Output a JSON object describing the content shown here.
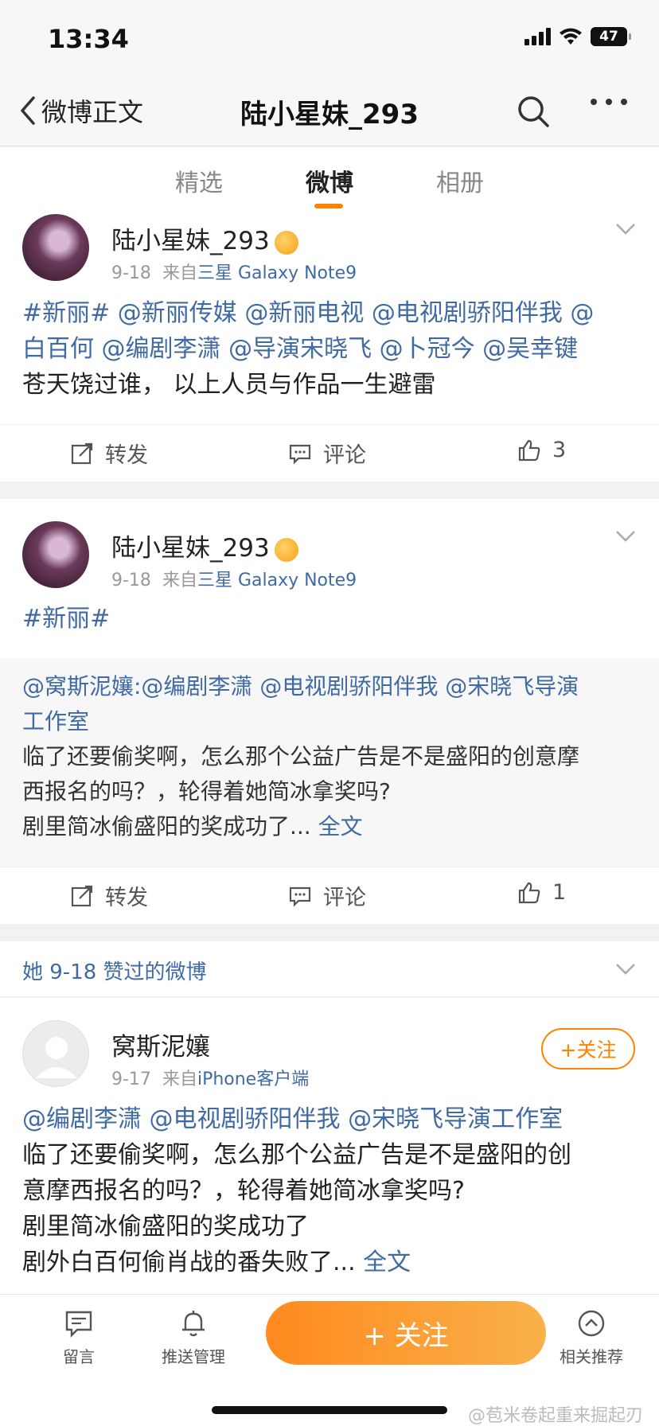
{
  "status": {
    "time": "13:34",
    "battery": "47"
  },
  "nav": {
    "back_label": "微博正文",
    "title": "陆小星妹_293"
  },
  "tabs": [
    {
      "label": "精选"
    },
    {
      "label": "微博"
    },
    {
      "label": "相册"
    }
  ],
  "post1": {
    "username": "陆小星妹_293",
    "date": "9-18",
    "source_prefix": "来自",
    "source": "三星 Galaxy Note9",
    "line1": "#新丽# @新丽传媒 @新丽电视 @电视剧骄阳伴我 @",
    "line2": "白百何 @编剧李潇 @导演宋晓飞  @卜冠今  @吴幸键",
    "line3": "苍天饶过谁， 以上人员与作品一生避雷",
    "repost": "转发",
    "comment": "评论",
    "likes": "3"
  },
  "post2": {
    "username": "陆小星妹_293",
    "date": "9-18",
    "source_prefix": "来自",
    "source": "三星 Galaxy Note9",
    "text": "#新丽#",
    "quote_line1": "@窝斯泥孃:@编剧李潇 @电视剧骄阳伴我 @宋晓飞导演",
    "quote_line2": "工作室",
    "quote_line3": "临了还要偷奖啊，怎么那个公益广告是不是盛阳的创意摩",
    "quote_line4": "西报名的吗？，轮得着她简冰拿奖吗?",
    "quote_line5": "剧里简冰偷盛阳的奖成功了...",
    "full_text": "全文",
    "repost": "转发",
    "comment": "评论",
    "likes": "1"
  },
  "liked_header": "她 9-18 赞过的微博",
  "post3": {
    "username": "窝斯泥孃",
    "date": "9-17",
    "source_prefix": "来自",
    "source": "iPhone客户端",
    "follow": "+关注",
    "line1": "@编剧李潇 @电视剧骄阳伴我 @宋晓飞导演工作室",
    "line2": "临了还要偷奖啊，怎么那个公益广告是不是盛阳的创",
    "line3": "意摩西报名的吗？，轮得着她简冰拿奖吗?",
    "line4": "剧里简冰偷盛阳的奖成功了",
    "line5": "剧外白百何偷肖战的番失败了...",
    "full_text": "全文"
  },
  "bottom": {
    "message": "留言",
    "push": "推送管理",
    "follow": "+ 关注",
    "recommend": "相关推荐",
    "watermark": "@苞米卷起重来掘起刃"
  },
  "colors": {
    "accent": "#ff8200",
    "link": "#3f6aa3"
  }
}
